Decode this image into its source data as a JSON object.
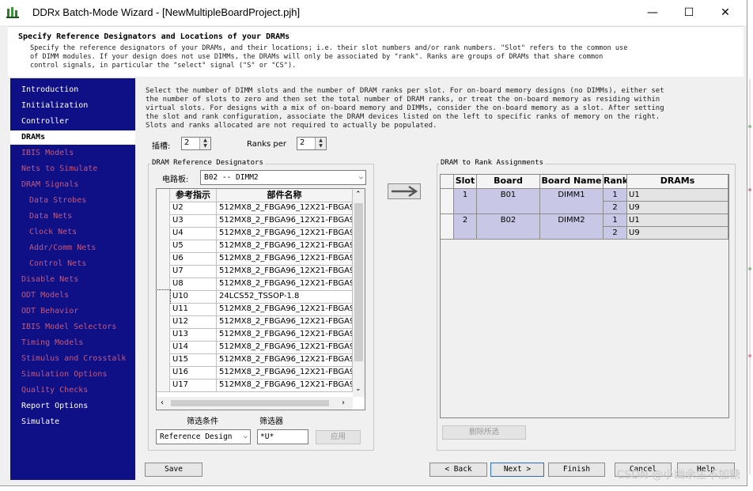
{
  "window": {
    "title": "DDRx Batch-Mode Wizard - [NewMultipleBoardProject.pjh]",
    "minimize": "—",
    "maximize": "☐",
    "close": "✕"
  },
  "header": {
    "title": "Specify Reference Designators and Locations of your DRAMs",
    "description": "Specify the reference designators of your DRAMs, and their locations; i.e. their slot numbers and/or rank numbers.  \"Slot\" refers to the common use\nof DIMM modules.  If your design does not use DIMMs, the DRAMs will only be associated by \"rank\".  Ranks are groups of DRAMs that share common\ncontrol signals, in particular the \"select\" signal (\"S\" or \"CS\")."
  },
  "nav": [
    {
      "label": "Introduction",
      "state": "done"
    },
    {
      "label": "Initialization",
      "state": "done"
    },
    {
      "label": "Controller",
      "state": "done"
    },
    {
      "label": "DRAMs",
      "state": "active"
    },
    {
      "label": "IBIS Models",
      "state": "pending"
    },
    {
      "label": "Nets to Simulate",
      "state": "pending"
    },
    {
      "label": "DRAM Signals",
      "state": "pending"
    },
    {
      "label": "Data Strobes",
      "state": "pending-sub"
    },
    {
      "label": "Data Nets",
      "state": "pending-sub"
    },
    {
      "label": "Clock Nets",
      "state": "pending-sub"
    },
    {
      "label": "Addr/Comm Nets",
      "state": "pending-sub"
    },
    {
      "label": "Control Nets",
      "state": "pending-sub"
    },
    {
      "label": "Disable Nets",
      "state": "pending"
    },
    {
      "label": "ODT Models",
      "state": "pending"
    },
    {
      "label": "ODT Behavior",
      "state": "pending"
    },
    {
      "label": "IBIS Model Selectors",
      "state": "pending"
    },
    {
      "label": "Timing Models",
      "state": "pending"
    },
    {
      "label": "Stimulus and Crosstalk",
      "state": "pending"
    },
    {
      "label": "Simulation Options",
      "state": "pending"
    },
    {
      "label": "Quality Checks",
      "state": "pending"
    },
    {
      "label": "Report Options",
      "state": "done"
    },
    {
      "label": "Simulate",
      "state": "done"
    }
  ],
  "intro": "Select the number of DIMM slots and the number of DRAM ranks per slot.  For on-board memory designs (no DIMMs), either set\nthe number of slots to zero and then set the total number of DRAM ranks, or treat the on-board memory as residing within\nvirtual slots.  For designs with a mix of on-board memory and DIMMs, consider the on-board memory as a slot.  After setting\nthe slot and rank configuration, associate the DRAM devices listed on the left to specific ranks of memory on the right.\nSlots and ranks allocated are not required to actually be populated.",
  "slots": {
    "label": "插槽:",
    "value": "2"
  },
  "ranks": {
    "label": "Ranks per",
    "value": "2"
  },
  "ref_designators": {
    "group_title": "DRAM Reference Designators",
    "board_label": "电路板:",
    "board_value": "B02 -- DIMM2",
    "columns": [
      "参考指示",
      "部件名称"
    ],
    "rows": [
      [
        "U2",
        "512MX8_2_FBGA96_12X21-FBGA9"
      ],
      [
        "U3",
        "512MX8_2_FBGA96_12X21-FBGA9"
      ],
      [
        "U4",
        "512MX8_2_FBGA96_12X21-FBGA9"
      ],
      [
        "U5",
        "512MX8_2_FBGA96_12X21-FBGA9"
      ],
      [
        "U6",
        "512MX8_2_FBGA96_12X21-FBGA9"
      ],
      [
        "U7",
        "512MX8_2_FBGA96_12X21-FBGA9"
      ],
      [
        "U8",
        "512MX8_2_FBGA96_12X21-FBGA9"
      ],
      [
        "U10",
        "24LCS52_TSSOP-1.8"
      ],
      [
        "U11",
        "512MX8_2_FBGA96_12X21-FBGA9"
      ],
      [
        "U12",
        "512MX8_2_FBGA96_12X21-FBGA9"
      ],
      [
        "U13",
        "512MX8_2_FBGA96_12X21-FBGA9"
      ],
      [
        "U14",
        "512MX8_2_FBGA96_12X21-FBGA9"
      ],
      [
        "U15",
        "512MX8_2_FBGA96_12X21-FBGA9"
      ],
      [
        "U16",
        "512MX8_2_FBGA96_12X21-FBGA9"
      ],
      [
        "U17",
        "512MX8_2_FBGA96_12X21-FBGA9"
      ]
    ],
    "filter_label": "筛选条件",
    "filter_value": "Reference Design",
    "filter2_label": "筛选器",
    "filter2_value": "*U*",
    "apply_label": "应用"
  },
  "assign": {
    "group_title": "DRAM to Rank Assignments",
    "columns": [
      "Slot",
      "Board",
      "Board Name",
      "Rank",
      "DRAMs"
    ],
    "slots": [
      {
        "slot": "1",
        "board": "B01",
        "board_name": "DIMM1",
        "ranks": [
          {
            "rank": "1",
            "drams": "U1"
          },
          {
            "rank": "2",
            "drams": "U9"
          }
        ]
      },
      {
        "slot": "2",
        "board": "B02",
        "board_name": "DIMM2",
        "ranks": [
          {
            "rank": "1",
            "drams": "U1"
          },
          {
            "rank": "2",
            "drams": "U9"
          }
        ]
      }
    ],
    "remove_label": "删除所选"
  },
  "buttons": {
    "save": "Save",
    "back": "< Back",
    "next": "Next >",
    "finish": "Finish",
    "cancel": "Cancel",
    "help": "Help"
  },
  "watermark": "CSDN @小幽余生不加糖"
}
